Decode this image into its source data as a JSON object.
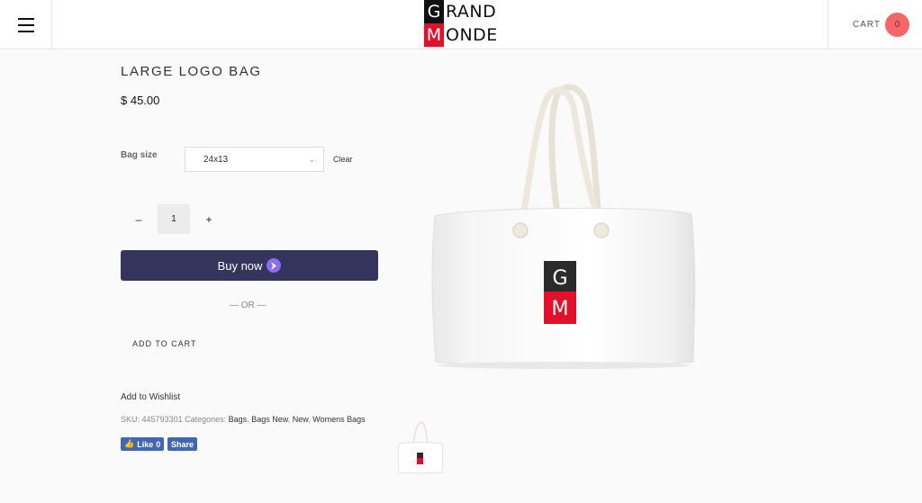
{
  "header": {
    "brand_line1_initial": "G",
    "brand_line1_rest": "RAND",
    "brand_line2_initial": "M",
    "brand_line2_rest": "ONDE",
    "cart_label": "CART",
    "cart_count": "0",
    "menu_icon": "hamburger-icon"
  },
  "product": {
    "title": "LARGE LOGO BAG",
    "price": "$ 45.00",
    "bag_size_label": "Bag size",
    "bag_size_value": "24x13",
    "clear_label": "Clear",
    "quantity": "1",
    "qty_minus": "–",
    "qty_plus": "+",
    "buy_now_label": "Buy now",
    "or_text": "— OR —",
    "add_to_cart_label": "ADD TO CART",
    "wishlist_label": "Add to Wishlist",
    "sku_label": "SKU:",
    "sku_value": "445793301",
    "categories_label": "Categories:",
    "categories": [
      "Bags",
      "Bags New",
      "New",
      "Womens Bags"
    ]
  },
  "social": {
    "like_label": "Like",
    "like_count": "0",
    "share_label": "Share"
  },
  "colors": {
    "buy_now_bg": "#34345c",
    "cart_badge": "#f96566",
    "brand_red": "#e3102a",
    "facebook_blue": "#4267b2"
  }
}
